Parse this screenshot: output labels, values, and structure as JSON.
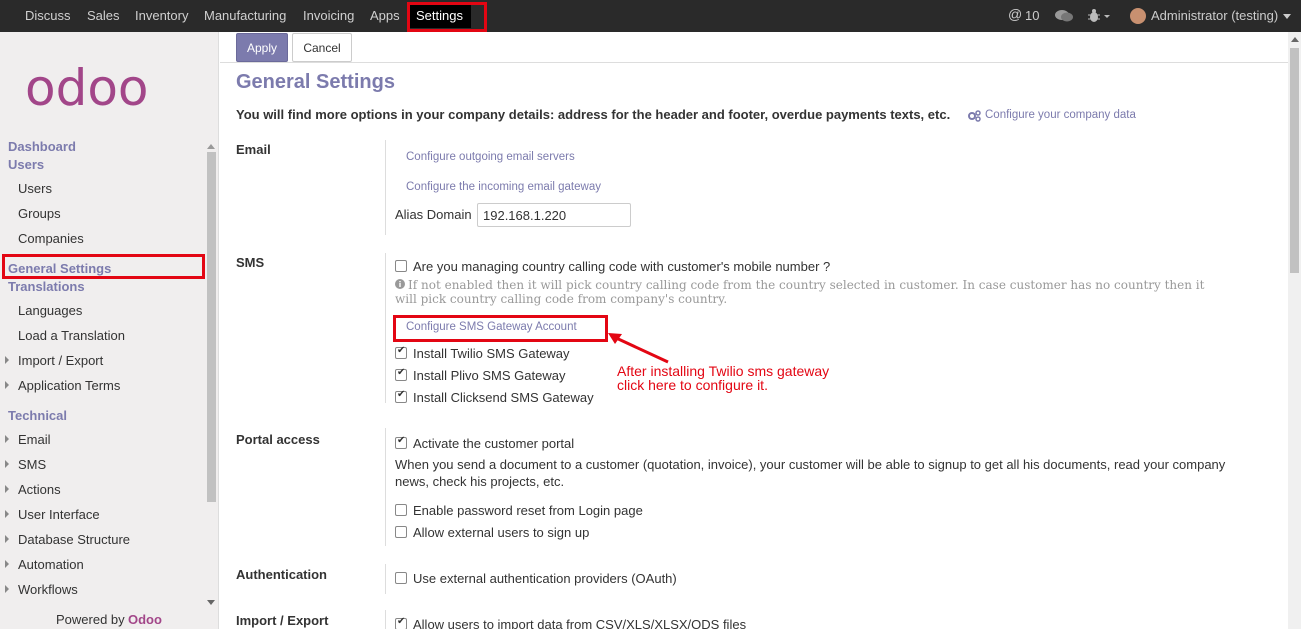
{
  "topbar": {
    "menu": [
      "Discuss",
      "Sales",
      "Inventory",
      "Manufacturing",
      "Invoicing",
      "Apps",
      "Settings"
    ],
    "mentions_count": "10",
    "user_label": "Administrator (testing)"
  },
  "sidebar": {
    "logo_text": "odoo",
    "dashboard": "Dashboard",
    "users_head": "Users",
    "users_items": [
      "Users",
      "Groups",
      "Companies"
    ],
    "general_settings": "General Settings",
    "translations_head": "Translations",
    "translations_items": [
      "Languages",
      "Load a Translation",
      "Import / Export",
      "Application Terms"
    ],
    "technical_head": "Technical",
    "technical_items": [
      "Email",
      "SMS",
      "Actions",
      "User Interface",
      "Database Structure",
      "Automation",
      "Workflows"
    ],
    "powered_by": "Powered by",
    "powered_brand": "Odoo"
  },
  "toolbar": {
    "apply": "Apply",
    "cancel": "Cancel"
  },
  "page": {
    "title": "General Settings",
    "intro": "You will find more options in your company details: address for the header and footer, overdue payments texts, etc.",
    "configure_company": "Configure your company data"
  },
  "email": {
    "title": "Email",
    "outgoing_link": "Configure outgoing email servers",
    "incoming_link": "Configure the incoming email gateway",
    "alias_label": "Alias Domain",
    "alias_value": "192.168.1.220"
  },
  "sms": {
    "title": "SMS",
    "country_code_label": "Are you managing country calling code with customer's mobile number ?",
    "country_code_checked": false,
    "help": "If not enabled then it will pick country calling code from the country selected in customer. In case customer has no country then it will pick country calling code from company's country.",
    "gateway_link": "Configure SMS Gateway Account",
    "gateways": [
      {
        "label": "Install Twilio SMS Gateway",
        "checked": true
      },
      {
        "label": "Install Plivo SMS Gateway",
        "checked": true
      },
      {
        "label": "Install Clicksend SMS Gateway",
        "checked": true
      }
    ]
  },
  "annotation": {
    "line1": "After installing Twilio sms gateway",
    "line2": "click here to configure it.",
    "color": "#e30613"
  },
  "portal": {
    "title": "Portal access",
    "activate_label": "Activate the customer portal",
    "activate_checked": true,
    "description": "When you send a document to a customer (quotation, invoice), your customer will be able to signup to get all his documents, read your company news, check his projects, etc.",
    "password_reset_label": "Enable password reset from Login page",
    "password_reset_checked": false,
    "external_signup_label": "Allow external users to sign up",
    "external_signup_checked": false
  },
  "authentication": {
    "title": "Authentication",
    "oauth_label": "Use external authentication providers (OAuth)",
    "oauth_checked": false
  },
  "import_export": {
    "title": "Import / Export",
    "csv_label": "Allow users to import data from CSV/XLS/XLSX/ODS files",
    "csv_checked": true
  },
  "colors": {
    "accent": "#7c7bad",
    "topbar": "#2a2a2a",
    "highlight": "#e30613"
  }
}
